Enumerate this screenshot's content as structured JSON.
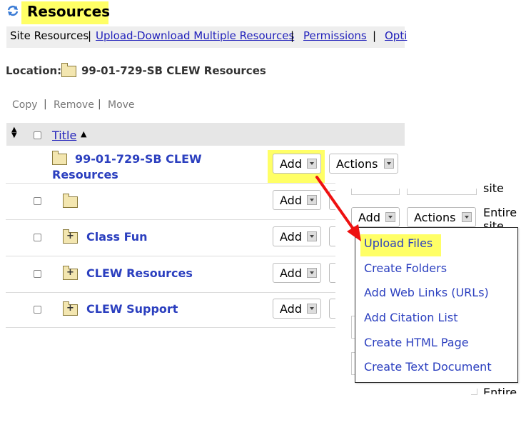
{
  "header": {
    "title": "Resources"
  },
  "toolbar": {
    "items": [
      "Site Resources",
      "Upload-Download Multiple Resources",
      "Permissions",
      "Opti"
    ],
    "sep": "|"
  },
  "location": {
    "label": "Location:",
    "path": "99-01-729-SB CLEW Resources"
  },
  "actions_bar": {
    "copy": "Copy",
    "remove": "Remove",
    "move": "Move",
    "sep": "|"
  },
  "table": {
    "header_title": "Title",
    "root_title": "99-01-729-SB CLEW Resources",
    "add_label": "Add",
    "actions_label": "Actions",
    "rows": [
      {
        "title": ""
      },
      {
        "title": "Class Fun"
      },
      {
        "title": "CLEW Resources"
      },
      {
        "title": "CLEW Support"
      }
    ]
  },
  "background_overlay": {
    "site_fragment": "site",
    "entire_site": "Entire site",
    "entire_fragment": "Entire",
    "add_label": "Add",
    "actions_label": "Actions"
  },
  "dropdown": {
    "items": [
      "Upload Files",
      "Create Folders",
      "Add Web Links (URLs)",
      "Add Citation List",
      "Create HTML Page",
      "Create Text Document"
    ]
  },
  "colors": {
    "highlight": "#ffff66",
    "link": "#2222bb",
    "arrow": "#ee1111"
  },
  "icons": {
    "refresh": "refresh-icon",
    "sort": "sort-arrows-icon",
    "folder": "folder-icon",
    "folder_plus": "folder-expand-icon"
  }
}
